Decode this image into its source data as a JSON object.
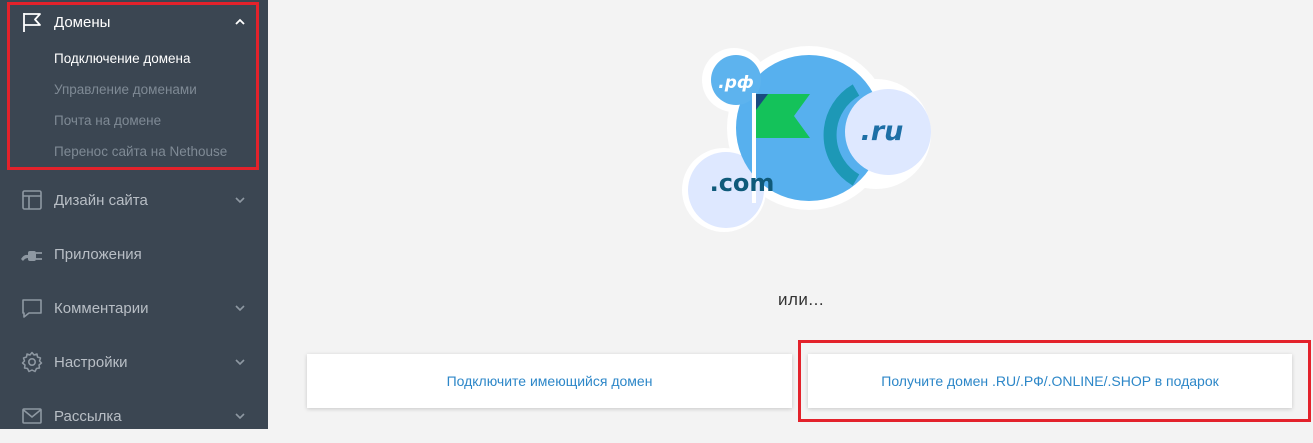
{
  "sidebar": {
    "domains": {
      "label": "Домены",
      "icon": "flag-icon",
      "expanded": true,
      "items": [
        {
          "label": "Подключение домена",
          "active": true
        },
        {
          "label": "Управление доменами",
          "active": false
        },
        {
          "label": "Почта на домене",
          "active": false
        },
        {
          "label": "Перенос сайта на Nethouse",
          "active": false
        }
      ]
    },
    "sections": [
      {
        "label": "Дизайн сайта",
        "icon": "layout-icon",
        "has_chevron": true
      },
      {
        "label": "Приложения",
        "icon": "plug-icon",
        "has_chevron": false
      },
      {
        "label": "Комментарии",
        "icon": "comment-icon",
        "has_chevron": true
      },
      {
        "label": "Настройки",
        "icon": "gear-icon",
        "has_chevron": true
      },
      {
        "label": "Рассылка",
        "icon": "envelope-icon",
        "has_chevron": true
      }
    ]
  },
  "illustration": {
    "badges": [
      ".рф",
      ".ru",
      ".com"
    ]
  },
  "main": {
    "or_text": "или...",
    "connect_existing": "Подключите имеющийся домен",
    "get_gift_domain": "Получите домен .RU/.РФ/.ONLINE/.SHOP в подарок"
  },
  "colors": {
    "sidebar_bg": "#3b4652",
    "accent_link": "#2d87c8",
    "highlight": "#e3222b",
    "flag_green": "#14c25a"
  }
}
